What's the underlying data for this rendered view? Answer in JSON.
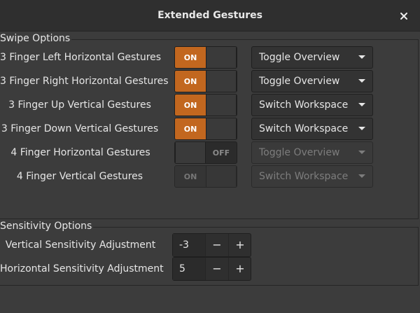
{
  "window": {
    "title": "Extended Gestures",
    "close_icon": "close-icon"
  },
  "swipe": {
    "section_label": "Swipe Options",
    "rows": [
      {
        "label": "3 Finger Left Horizontal Gestures",
        "switch_state": "on",
        "switch_text": "ON",
        "action": "Toggle Overview",
        "enabled": true
      },
      {
        "label": "3 Finger Right Horizontal Gestures",
        "switch_state": "on",
        "switch_text": "ON",
        "action": "Toggle Overview",
        "enabled": true
      },
      {
        "label": "3 Finger Up Vertical Gestures",
        "switch_state": "on",
        "switch_text": "ON",
        "action": "Switch Workspace",
        "enabled": true
      },
      {
        "label": "3 Finger Down Vertical Gestures",
        "switch_state": "on",
        "switch_text": "ON",
        "action": "Switch Workspace",
        "enabled": true
      },
      {
        "label": "4 Finger Horizontal Gestures",
        "switch_state": "off",
        "switch_text": "OFF",
        "action": "Toggle Overview",
        "enabled": false
      },
      {
        "label": "4 Finger Vertical Gestures",
        "switch_state": "on",
        "switch_text": "ON",
        "action": "Switch Workspace",
        "enabled": false
      }
    ]
  },
  "sensitivity": {
    "section_label": "Sensitivity Options",
    "rows": [
      {
        "label": "Vertical Sensitivity Adjustment",
        "value": "-3",
        "minus": "−",
        "plus": "+"
      },
      {
        "label": "Horizontal Sensitivity Adjustment",
        "value": "5",
        "minus": "−",
        "plus": "+"
      }
    ]
  },
  "colors": {
    "accent": "#c2671f",
    "window_bg": "#3c3c3c",
    "titlebar_bg": "#2f2f2f",
    "text": "#e6e6e6",
    "disabled_text": "#7d7d7d"
  }
}
